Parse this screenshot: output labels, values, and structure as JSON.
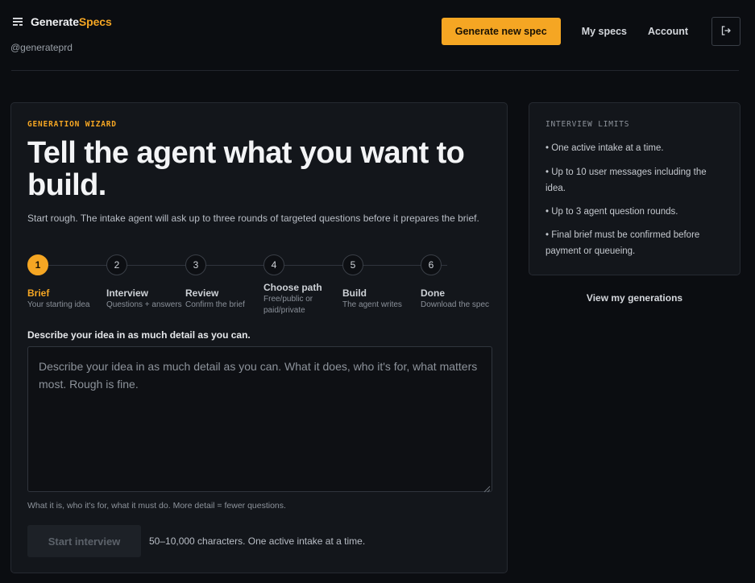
{
  "brand": {
    "name_main": "Generate",
    "name_accent": "Specs",
    "handle": "@generateprd",
    "accent_color": "#f5a623"
  },
  "nav": {
    "primary_cta": "Generate new spec",
    "links": [
      "My specs",
      "Account"
    ],
    "logout_icon": "logout-icon"
  },
  "wizard": {
    "eyebrow": "GENERATION WIZARD",
    "title": "Tell the agent what you want to build.",
    "lede": "Start rough. The intake agent will ask up to three rounds of targeted questions before it prepares the brief.",
    "current_step": 1,
    "steps": [
      {
        "num": "1",
        "title": "Brief",
        "sub": "Your starting idea"
      },
      {
        "num": "2",
        "title": "Interview",
        "sub": "Questions + answers"
      },
      {
        "num": "3",
        "title": "Review",
        "sub": "Confirm the brief"
      },
      {
        "num": "4",
        "title": "Choose path",
        "sub": "Free/public or paid/private"
      },
      {
        "num": "5",
        "title": "Build",
        "sub": "The agent writes"
      },
      {
        "num": "6",
        "title": "Done",
        "sub": "Download the spec"
      }
    ],
    "field_label": "Describe your idea in as much detail as you can.",
    "placeholder": "Describe your idea in as much detail as you can. What it does, who it's for, what matters most. Rough is fine.",
    "value": "",
    "hint": "What it is, who it's for, what it must do. More detail = fewer questions.",
    "start_button": "Start interview",
    "start_note": "50–10,000 characters. One active intake at a time."
  },
  "limits": {
    "eyebrow": "INTERVIEW LIMITS",
    "items": [
      "• One active intake at a time.",
      "• Up to 10 user messages including the idea.",
      "• Up to 3 agent question rounds.",
      "• Final brief must be confirmed before payment or queueing."
    ],
    "view_link": "View my generations"
  }
}
